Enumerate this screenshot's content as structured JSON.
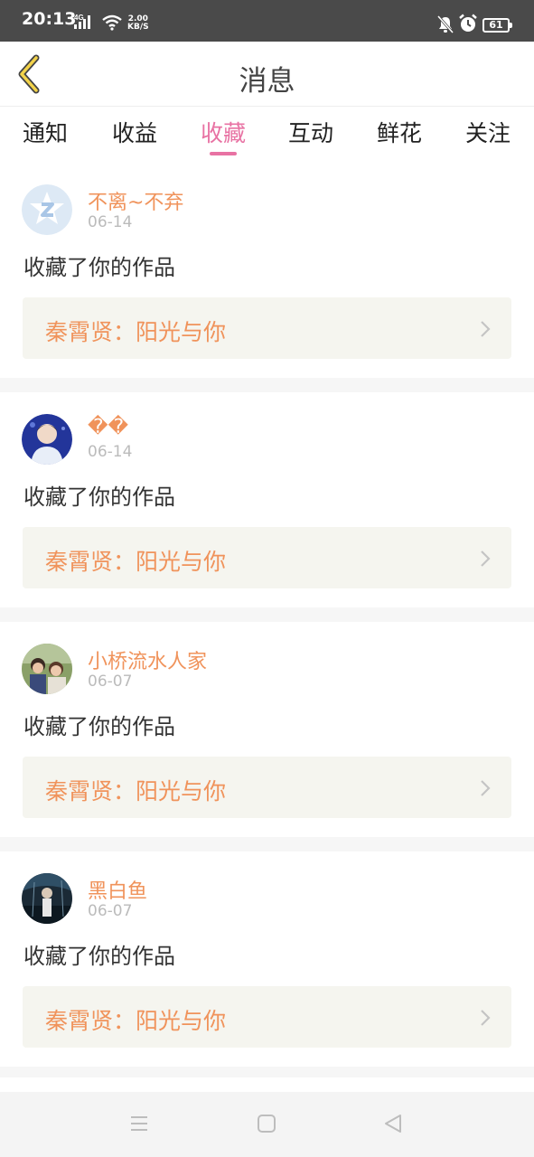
{
  "status_bar": {
    "time": "20:13",
    "network": "4G",
    "speed_value": "2.00",
    "speed_unit": "KB/S",
    "battery": "61",
    "icons": [
      "signal-icon",
      "wifi-icon",
      "bell-off-icon",
      "alarm-icon",
      "battery-icon"
    ]
  },
  "header": {
    "title": "消息",
    "back_icon": "chevron-left-icon"
  },
  "tabs": [
    {
      "label": "通知",
      "active": false
    },
    {
      "label": "收益",
      "active": false
    },
    {
      "label": "收藏",
      "active": true
    },
    {
      "label": "互动",
      "active": false
    },
    {
      "label": "鲜花",
      "active": false
    },
    {
      "label": "关注",
      "active": false
    }
  ],
  "messages": [
    {
      "username": "不离~不弃",
      "date": "06-14",
      "action": "收藏了你的作品",
      "work": "秦霄贤：阳光与你"
    },
    {
      "username": "��",
      "date": "06-14",
      "action": "收藏了你的作品",
      "work": "秦霄贤：阳光与你"
    },
    {
      "username": "小桥流水人家",
      "date": "06-07",
      "action": "收藏了你的作品",
      "work": "秦霄贤：阳光与你"
    },
    {
      "username": "黑白鱼",
      "date": "06-07",
      "action": "收藏了你的作品",
      "work": "秦霄贤：阳光与你"
    }
  ],
  "nav_bar": {
    "icons": [
      "menu-icon",
      "home-icon",
      "back-icon"
    ]
  },
  "colors": {
    "accent_pink": "#e872a3",
    "accent_orange": "#f0935b",
    "status_bar": "#4a4a4a",
    "link_bg": "#f5f5ef"
  }
}
